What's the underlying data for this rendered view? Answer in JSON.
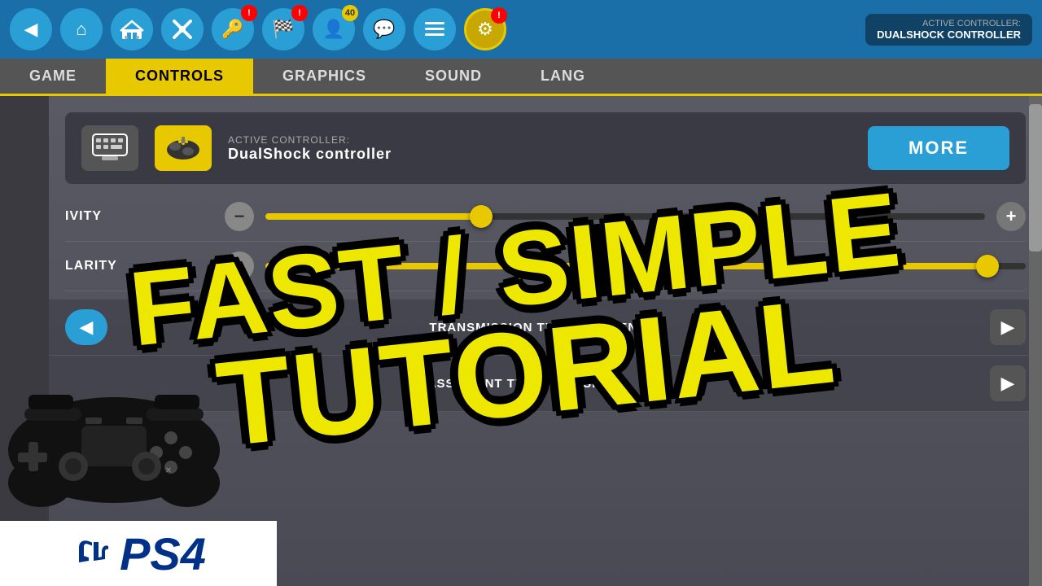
{
  "topNav": {
    "icons": [
      {
        "name": "back-icon",
        "symbol": "◀",
        "style": "back",
        "badge": null
      },
      {
        "name": "home-icon",
        "symbol": "⌂",
        "style": "home",
        "badge": null
      },
      {
        "name": "garage-icon",
        "symbol": "🏎",
        "style": "garage",
        "badge": null
      },
      {
        "name": "tools-icon",
        "symbol": "🔧",
        "style": "tools",
        "badge": null
      },
      {
        "name": "keys-icon",
        "symbol": "🔑",
        "style": "keys",
        "badge": {
          "value": "!",
          "color": "red"
        }
      },
      {
        "name": "flag-icon",
        "symbol": "🚩",
        "style": "flag",
        "badge": {
          "value": "!",
          "color": "red"
        }
      },
      {
        "name": "person-icon",
        "symbol": "👤",
        "style": "person",
        "badge": {
          "value": "40",
          "color": "yellow"
        }
      },
      {
        "name": "chat-icon",
        "symbol": "💬",
        "style": "chat",
        "badge": null
      },
      {
        "name": "list-icon",
        "symbol": "≡",
        "style": "list",
        "badge": null
      },
      {
        "name": "gear-icon",
        "symbol": "⚙",
        "style": "gear",
        "badge": {
          "value": "!",
          "color": "red"
        }
      }
    ]
  },
  "controllerInfo": {
    "label": "ACTIVE CONTROLLER:",
    "value": "DUALSHOCK CONTROLLER"
  },
  "tabs": [
    {
      "label": "GAME",
      "active": false
    },
    {
      "label": "CONTROLS",
      "active": true
    },
    {
      "label": "GRAPHICS",
      "active": false
    },
    {
      "label": "SOUND",
      "active": false
    },
    {
      "label": "LANG",
      "active": false
    }
  ],
  "controllerSelectArea": {
    "entryLabel": "ACTIVE CONTROLLER:",
    "controllerName": "DualShock controller",
    "moreButtonLabel": "MORE"
  },
  "sliders": [
    {
      "label": "SENSITIVITY",
      "shortLabel": "IVITY",
      "fillPercent": 30,
      "thumbPercent": 30
    },
    {
      "label": "CLARITY",
      "shortLabel": "LARITY",
      "fillPercent": 95,
      "thumbPercent": 95
    }
  ],
  "optionRows": [
    {
      "label": "TRANSMISSION TYPE: SEQUENTIAL",
      "hasLeftArrow": true,
      "hasRightArrow": true
    },
    {
      "label": "ASSISTANT TYPE · VERSION 3",
      "hasLeftArrow": false,
      "hasRightArrow": true
    }
  ],
  "tutorialOverlay": {
    "line1": "FAST / SIMPLE",
    "line2": "TUTORIAL"
  },
  "ps4Logo": {
    "text": "PS4"
  },
  "colors": {
    "accent": "#e8c800",
    "blue": "#2a9fd6",
    "dark": "#3a3a45",
    "tabBg": "#555555"
  }
}
